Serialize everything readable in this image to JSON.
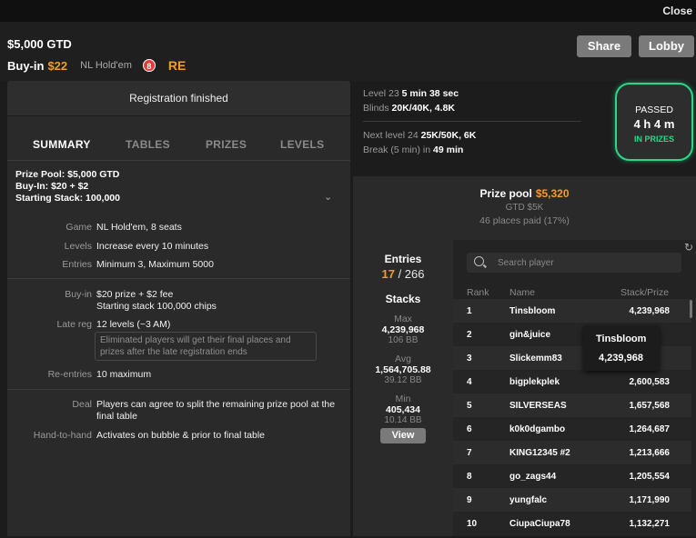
{
  "topbar": {
    "close_label": "Close"
  },
  "header": {
    "title": "$5,000 GTD",
    "buyin_label": "Buy-in",
    "buyin_amount": "$22",
    "game": "NL Hold'em",
    "badge": "8",
    "re_tag": "RE",
    "share_label": "Share",
    "lobby_label": "Lobby"
  },
  "registration": {
    "status": "Registration finished"
  },
  "tabs": [
    {
      "label": "SUMMARY",
      "active": true
    },
    {
      "label": "TABLES",
      "active": false
    },
    {
      "label": "PRIZES",
      "active": false
    },
    {
      "label": "LEVELS",
      "active": false
    }
  ],
  "summary": {
    "prize_pool": "Prize Pool: $5,000 GTD",
    "buy_in": "Buy-In: $20 + $2",
    "starting_stack": "Starting Stack: 100,000",
    "rows": {
      "game": {
        "key": "Game",
        "value": "NL Hold'em, 8 seats"
      },
      "levels": {
        "key": "Levels",
        "value": "Increase every 10 minutes"
      },
      "entries": {
        "key": "Entries",
        "value": "Minimum 3, Maximum 5000"
      },
      "buyin": {
        "key": "Buy-in",
        "value": "$20 prize + $2 fee",
        "value2": "Starting stack 100,000 chips"
      },
      "latereg": {
        "key": "Late reg",
        "value": "12 levels (~3 AM)",
        "note": "Eliminated players will get their final places and prizes after the late registration ends"
      },
      "reentries": {
        "key": "Re-entries",
        "value": "10 maximum"
      },
      "deal": {
        "key": "Deal",
        "value": "Players can agree to split the remaining prize pool at the final table"
      },
      "handtohand": {
        "key": "Hand-to-hand",
        "value": "Activates on bubble & prior to final table"
      }
    }
  },
  "level_info": {
    "current_prefix": "Level 23",
    "current_time": "5 min 38 sec",
    "blinds_prefix": "Blinds",
    "blinds": "20K/40K, 4.8K",
    "next_prefix": "Next level 24",
    "next_blinds": "25K/50K, 6K",
    "break_prefix": "Break (5 min) in",
    "break_time": "49 min"
  },
  "passed": {
    "label": "PASSED",
    "time": "4 h 4 m",
    "status": "IN PRIZES"
  },
  "prize_pool": {
    "title": "Prize pool",
    "amount": "$5,320",
    "gtd": "GTD $5K",
    "places": "46 places paid (17%)"
  },
  "stats": {
    "entries_label": "Entries",
    "entries_current": "17",
    "entries_sep": " / ",
    "entries_total": "266",
    "stacks_label": "Stacks",
    "max_label": "Max",
    "max_value": "4,239,968",
    "max_bb": "106 BB",
    "avg_label": "Avg",
    "avg_value": "1,564,705.88",
    "avg_bb": "39.12 BB",
    "min_label": "Min",
    "min_value": "405,434",
    "min_bb": "10.14 BB",
    "view_label": "View"
  },
  "leaderboard": {
    "search_placeholder": "Search player",
    "col_rank": "Rank",
    "col_name": "Name",
    "col_stack": "Stack/Prize",
    "rows": [
      {
        "rank": "1",
        "name": "Tinsbloom",
        "stack": "4,239,968"
      },
      {
        "rank": "2",
        "name": "gin&juice",
        "stack": ""
      },
      {
        "rank": "3",
        "name": "Slickemm83",
        "stack": ""
      },
      {
        "rank": "4",
        "name": "bigplekplek",
        "stack": "2,600,583"
      },
      {
        "rank": "5",
        "name": "SILVERSEAS",
        "stack": "1,657,568"
      },
      {
        "rank": "6",
        "name": "k0k0dgambo",
        "stack": "1,264,687"
      },
      {
        "rank": "7",
        "name": "KING12345 #2",
        "stack": "1,213,666"
      },
      {
        "rank": "8",
        "name": "go_zags44",
        "stack": "1,205,554"
      },
      {
        "rank": "9",
        "name": "yungfalc",
        "stack": "1,171,990"
      },
      {
        "rank": "10",
        "name": "CiupaCiupa78",
        "stack": "1,132,271"
      }
    ],
    "tooltip": {
      "name": "Tinsbloom",
      "stack": "4,239,968"
    }
  },
  "colors": {
    "accent_orange": "#f39c28",
    "accent_green": "#27d889",
    "badge_red": "#e53935"
  }
}
